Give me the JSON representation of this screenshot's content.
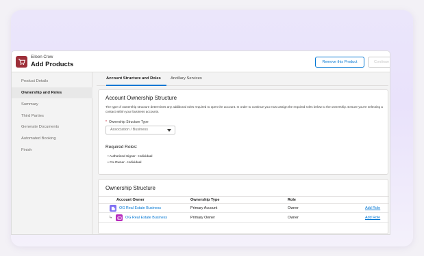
{
  "header": {
    "subtitle": "Eileen Crow",
    "title": "Add Products",
    "remove_label": "Remove this Product",
    "continue_label": "Continue"
  },
  "sidebar": {
    "items": [
      {
        "label": "Product Details",
        "active": false
      },
      {
        "label": "Ownership and Roles",
        "active": true
      },
      {
        "label": "Summary",
        "active": false
      },
      {
        "label": "Third Parties",
        "active": false
      },
      {
        "label": "Generate Documents",
        "active": false
      },
      {
        "label": "Automated Booking",
        "active": false
      },
      {
        "label": "Finish",
        "active": false
      }
    ]
  },
  "tabs": [
    {
      "label": "Account Structure and Roles",
      "active": true
    },
    {
      "label": "Ancillary Services",
      "active": false
    }
  ],
  "account_structure": {
    "title": "Account Ownership Structure",
    "description": "The type of ownership structure determines any additional roles required to open the account. In order to continue you must assign the required roles below to the ownership. Ensure you're selecting a contact within your business accounts.",
    "field_required_mark": "*",
    "field_label": "Ownership Structure Type",
    "field_value": "Association / Business",
    "roles_title": "Required Roles:",
    "roles": [
      "• Authorized Signer - Individual",
      "• Co-Owner - Individual"
    ]
  },
  "ownership": {
    "title": "Ownership Structure",
    "columns": [
      "Account Owner",
      "Ownership Type",
      "Role"
    ],
    "rows": [
      {
        "owner": "OG Real Estate Business",
        "type": "Primary Account",
        "role": "Owner",
        "action": "Add Role",
        "icon": "business-icon"
      },
      {
        "owner": "OG Real Estate Business",
        "type": "Primary Owner",
        "role": "Owner",
        "action": "Add Role",
        "icon": "contact-card-icon"
      }
    ]
  },
  "colors": {
    "brand_blue": "#0176d3",
    "header_icon": "#9d2f39",
    "business_icon": "#7f6ff2",
    "contact_icon": "#b72bbd"
  }
}
